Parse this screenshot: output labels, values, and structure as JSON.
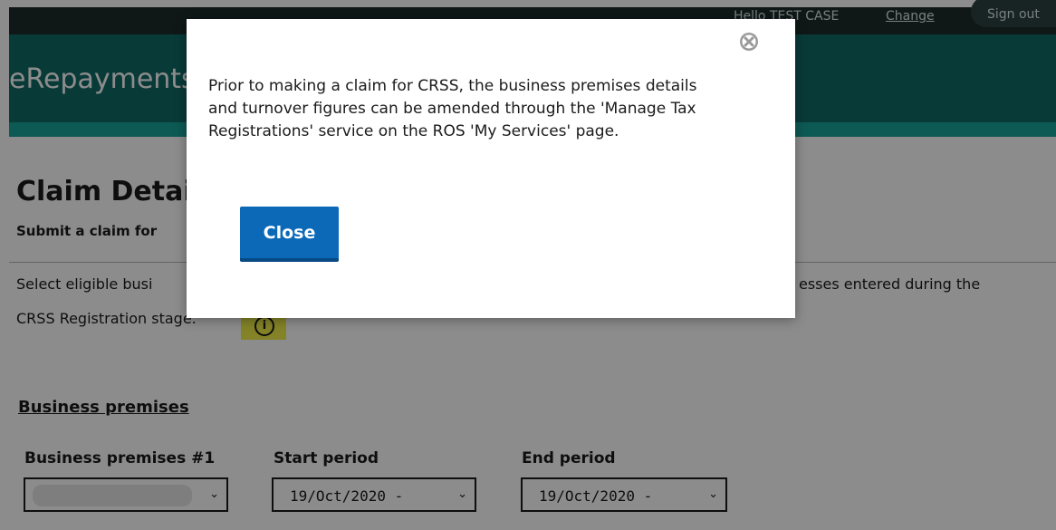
{
  "header": {
    "greeting": "Hello TEST CASE",
    "link_label": "Change",
    "signout_label": "Sign out"
  },
  "banner": {
    "title": "eRepayments"
  },
  "claim": {
    "heading": "Claim Details",
    "subheading": "Submit a claim for",
    "intro_line1": "Select eligible busi",
    "intro_tail": "esses entered during the",
    "intro_line2": "CRSS Registration stage."
  },
  "premises": {
    "section_title": "Business premises",
    "fields": [
      {
        "label": "Business premises #1",
        "value": ""
      },
      {
        "label": "Start period",
        "value": "19/Oct/2020 -"
      },
      {
        "label": "End period",
        "value": "19/Oct/2020 -"
      }
    ]
  },
  "dialog": {
    "message_lines": [
      "Prior to making a claim for CRSS, the business premises details",
      "and turnover figures can be amended through the 'Manage Tax",
      "Registrations' service on the ROS 'My Services' page."
    ],
    "close_label": "Close",
    "close_icon": "close-x-circle-icon"
  },
  "colors": {
    "topbar": "#1c2b2b",
    "banner": "#0f6b67",
    "banner_rule": "#18a39a",
    "primary_button": "#0b69b7",
    "info_highlight": "#f0ef4a"
  }
}
